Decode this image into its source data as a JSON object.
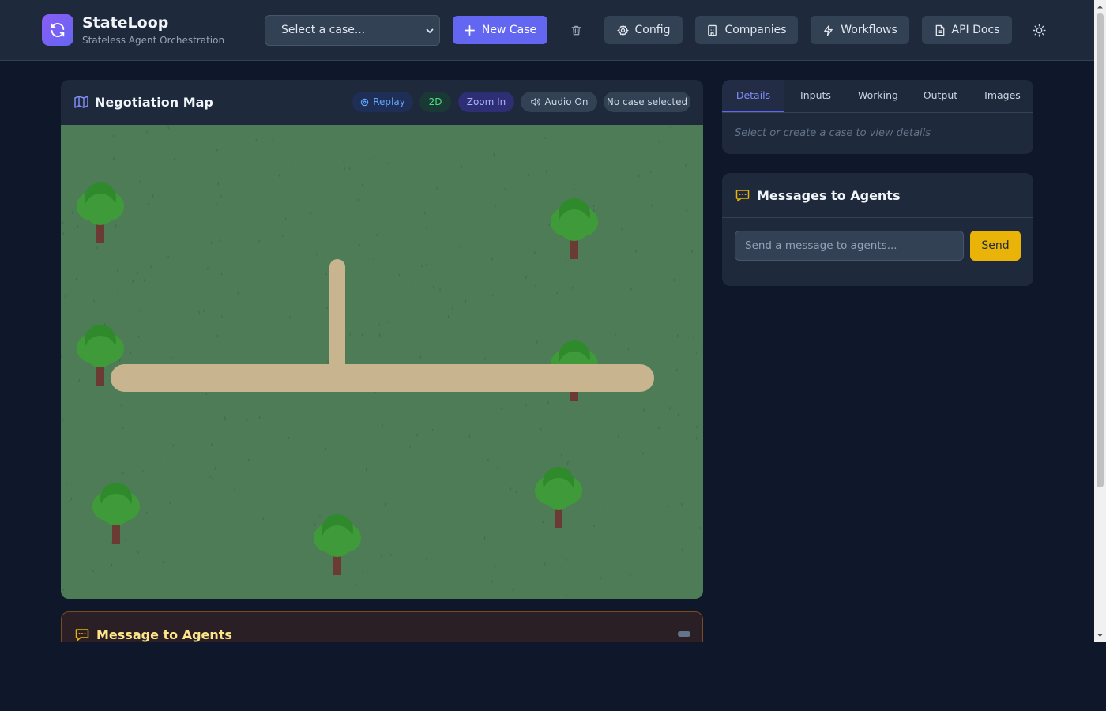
{
  "app": {
    "title": "StateLoop",
    "subtitle": "Stateless Agent Orchestration"
  },
  "header": {
    "case_select_value": "Select a case...",
    "new_case_label": "New Case",
    "config_label": "Config",
    "companies_label": "Companies",
    "workflows_label": "Workflows",
    "api_docs_label": "API Docs"
  },
  "map": {
    "title": "Negotiation Map",
    "controls": {
      "replay": "Replay",
      "mode": "2D",
      "zoom": "Zoom In",
      "audio": "Audio On",
      "status": "No case selected"
    }
  },
  "details": {
    "tabs": [
      "Details",
      "Inputs",
      "Working",
      "Output",
      "Images"
    ],
    "active_tab": "Details",
    "empty_text": "Select or create a case to view details"
  },
  "messages": {
    "title": "Messages to Agents",
    "input_placeholder": "Send a message to agents...",
    "send_label": "Send"
  },
  "bottom_panel": {
    "title": "Message to Agents"
  },
  "colors": {
    "accent": "#6366f1",
    "send": "#eab308",
    "grass": "#4d7c57",
    "path": "#c8b48e",
    "tree_foliage": "#3f9b3a",
    "tree_trunk": "#6b3a32"
  },
  "icons": {
    "logo": "refresh-icon",
    "delete": "trash-icon",
    "config": "gear-icon",
    "companies": "building-icon",
    "workflows": "bolt-icon",
    "api_docs": "document-icon",
    "theme": "sun-icon",
    "map": "map-icon",
    "messages": "chat-icon"
  }
}
